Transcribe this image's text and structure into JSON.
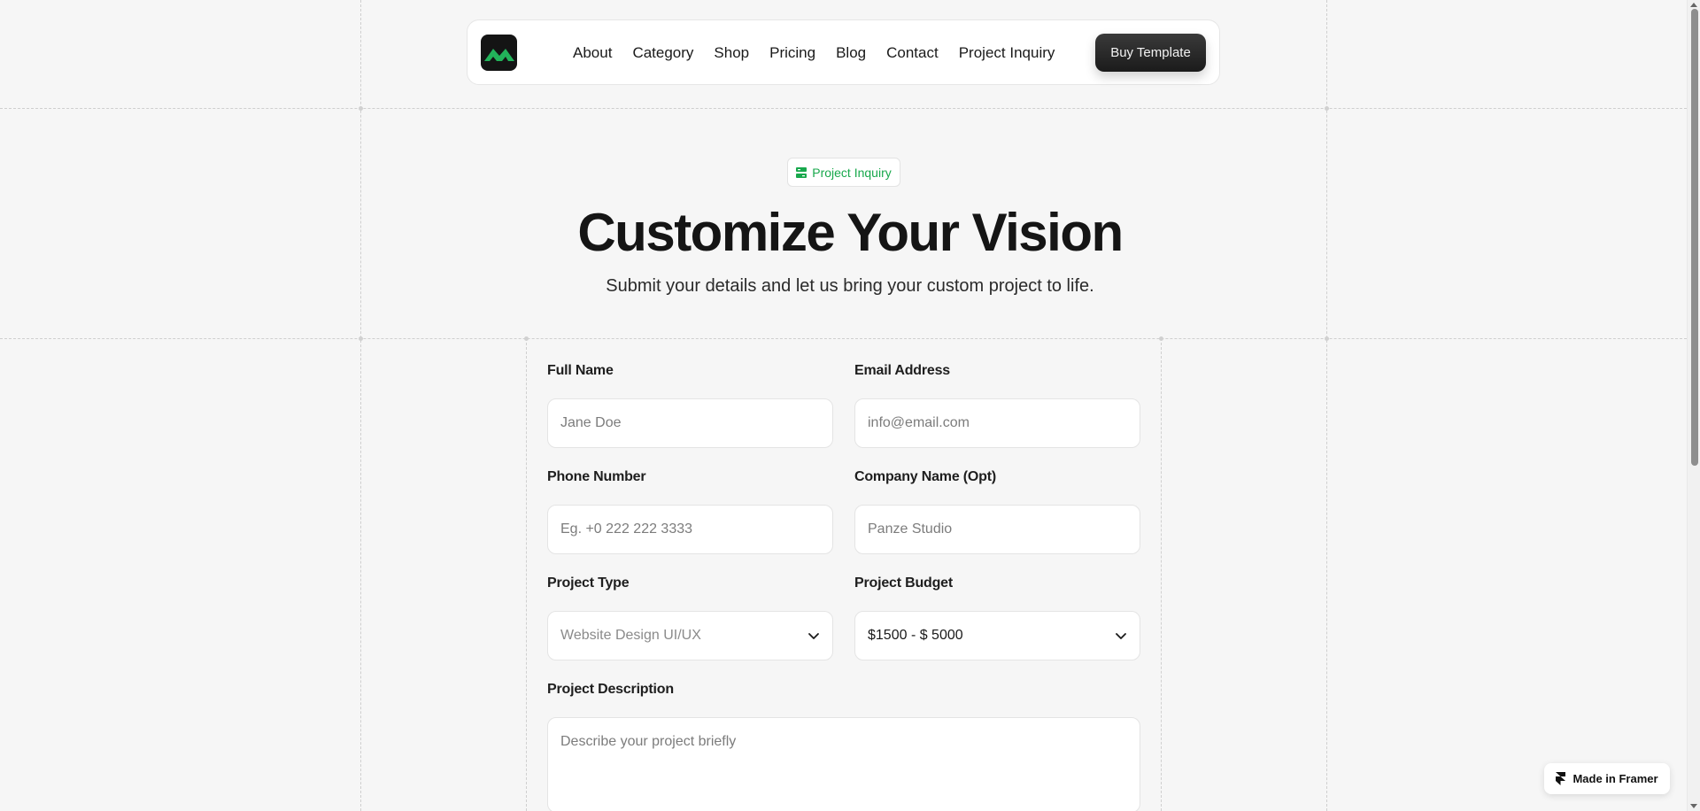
{
  "nav": {
    "links": [
      "About",
      "Category",
      "Shop",
      "Pricing",
      "Blog",
      "Contact",
      "Project Inquiry"
    ],
    "cta": "Buy Template"
  },
  "hero": {
    "badge": "Project Inquiry",
    "title": "Customize Your Vision",
    "subtitle": "Submit your details and let us bring your custom project to life."
  },
  "form": {
    "full_name": {
      "label": "Full Name",
      "placeholder": "Jane Doe"
    },
    "email": {
      "label": "Email Address",
      "placeholder": "info@email.com"
    },
    "phone": {
      "label": "Phone Number",
      "placeholder": "Eg. +0 222 222 3333"
    },
    "company": {
      "label": "Company Name (Opt)",
      "placeholder": "Panze Studio"
    },
    "project_type": {
      "label": "Project Type",
      "value": "Website Design UI/UX"
    },
    "project_budget": {
      "label": "Project Budget",
      "value": "$1500 - $ 5000"
    },
    "description": {
      "label": "Project Description",
      "placeholder": "Describe your project briefly"
    }
  },
  "framer_badge": "Made in Framer",
  "colors": {
    "accent": "#18a84c",
    "cta_bg": "#1b1b1b",
    "page_bg": "#f6f6f6"
  }
}
